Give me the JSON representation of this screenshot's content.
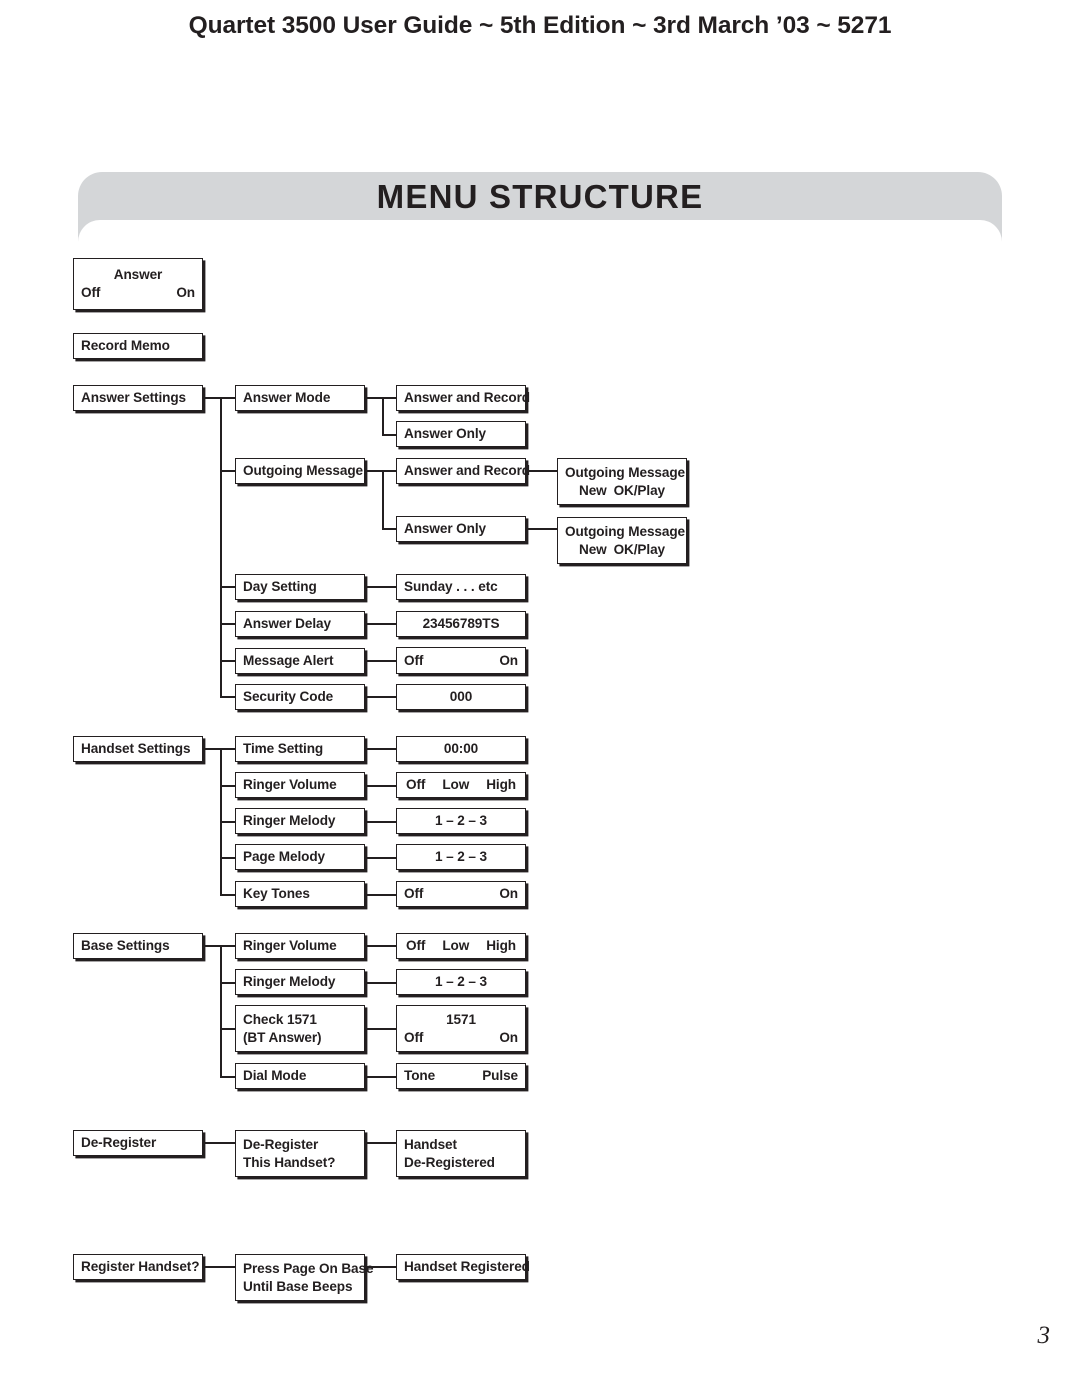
{
  "header": {
    "running_head": "Quartet 3500 User Guide ~ 5th Edition ~ 3rd March ’03 ~ 5271"
  },
  "banner": {
    "title": "MENU STRUCTURE",
    "fill_color": "#d4d6d8"
  },
  "folio": {
    "page_number": "3"
  },
  "colors": {
    "ink": "#231f20",
    "paper": "#ffffff",
    "banner": "#d4d6d8"
  },
  "diagram": {
    "type": "menu-tree",
    "nodes": {
      "answer_toggle": {
        "line1": "Answer",
        "line2_left": "Off",
        "line2_right": "On"
      },
      "record_memo": {
        "line1": "Record Memo"
      },
      "answer_settings": {
        "line1": "Answer Settings"
      },
      "answer_mode": {
        "line1": "Answer Mode"
      },
      "answer_mode_opt1": {
        "line1": "Answer and Record"
      },
      "answer_mode_opt2": {
        "line1": "Answer Only"
      },
      "outgoing_message": {
        "line1": "Outgoing Message"
      },
      "ogm_opt1": {
        "line1": "Answer and Record"
      },
      "ogm_opt2": {
        "line1": "Answer Only"
      },
      "ogm_panel1": {
        "line1": "Outgoing Message",
        "line2_left": "New",
        "line2_right": "OK/Play"
      },
      "ogm_panel2": {
        "line1": "Outgoing Message",
        "line2_left": "New",
        "line2_right": "OK/Play"
      },
      "day_setting": {
        "line1": "Day Setting"
      },
      "day_setting_val": {
        "line1": "Sunday . . . etc"
      },
      "answer_delay": {
        "line1": "Answer Delay"
      },
      "answer_delay_val": {
        "line1": "23456789TS"
      },
      "message_alert": {
        "line1": "Message Alert"
      },
      "message_alert_val": {
        "line1_left": "Off",
        "line1_right": "On"
      },
      "security_code": {
        "line1": "Security Code"
      },
      "security_code_val": {
        "line1": "000"
      },
      "handset_settings": {
        "line1": "Handset Settings"
      },
      "time_setting": {
        "line1": "Time Setting"
      },
      "time_setting_val": {
        "line1": "00:00"
      },
      "hs_ringer_volume": {
        "line1": "Ringer Volume"
      },
      "hs_ringer_volume_val": {
        "opt1": "Off",
        "opt2": "Low",
        "opt3": "High"
      },
      "hs_ringer_melody": {
        "line1": "Ringer Melody"
      },
      "hs_ringer_melody_val": {
        "line1": "1 – 2 – 3"
      },
      "page_melody": {
        "line1": "Page Melody"
      },
      "page_melody_val": {
        "line1": "1 – 2 – 3"
      },
      "key_tones": {
        "line1": "Key Tones"
      },
      "key_tones_val": {
        "line1_left": "Off",
        "line1_right": "On"
      },
      "base_settings": {
        "line1": "Base Settings"
      },
      "bs_ringer_volume": {
        "line1": "Ringer Volume"
      },
      "bs_ringer_volume_val": {
        "opt1": "Off",
        "opt2": "Low",
        "opt3": "High"
      },
      "bs_ringer_melody": {
        "line1": "Ringer Melody"
      },
      "bs_ringer_melody_val": {
        "line1": "1 – 2 – 3"
      },
      "check_1571": {
        "line1": "Check 1571",
        "line2": "(BT Answer)"
      },
      "check_1571_val": {
        "line1": "1571",
        "line2_left": "Off",
        "line2_right": "On"
      },
      "dial_mode": {
        "line1": "Dial Mode"
      },
      "dial_mode_val": {
        "line1_left": "Tone",
        "line1_right": "Pulse"
      },
      "deregister": {
        "line1": "De-Register"
      },
      "deregister_confirm": {
        "line1": "De-Register",
        "line2": "This Handset?"
      },
      "deregister_done": {
        "line1": "Handset",
        "line2": "De-Registered"
      },
      "register_handset": {
        "line1": "Register Handset?"
      },
      "register_instruct": {
        "line1": "Press Page On Base",
        "line2": "Until Base Beeps"
      },
      "register_done": {
        "line1": "Handset Registered"
      }
    }
  }
}
